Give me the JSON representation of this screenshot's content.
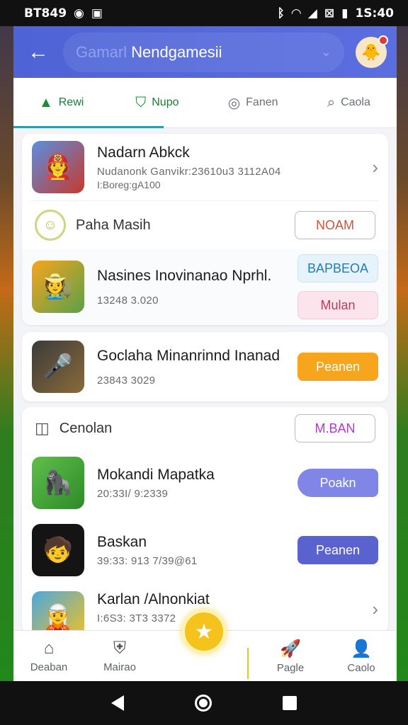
{
  "status_bar": {
    "left_text": "BT849",
    "time": "1S:40"
  },
  "header": {
    "search_placeholder": "Gamarl",
    "search_text": "Nendgamesii",
    "chevron": "⌄"
  },
  "tabs": [
    {
      "label": "Rewi",
      "icon": "warning-triangle-icon"
    },
    {
      "label": "Nupo",
      "icon": "badge-icon"
    },
    {
      "label": "Fanen",
      "icon": "chat-icon"
    },
    {
      "label": "Caola",
      "icon": "search-icon"
    }
  ],
  "card1": {
    "title": "Nadarn Abkck",
    "sub": "Nudanonk Ganvikr:23610u3 3112A04",
    "sub2": "I:Boreg:gA100"
  },
  "section_pala": {
    "label": "Paha Masih",
    "button": "NOAM"
  },
  "app_nasines": {
    "title": "Nasines Inovinanao Nprhl.",
    "sub": "13248 3.020",
    "button1": "BAPBEOA",
    "button2": "Mulan"
  },
  "app_goclaha": {
    "title": "Goclaha Minanrinnd Inanad",
    "sub": "23843 3029",
    "button": "Peanen"
  },
  "section_cenolan": {
    "label": "Cenolan",
    "button": "M.BAN"
  },
  "app_mokandi": {
    "title": "Mokandi Mapatka",
    "sub": "20:33I/ 9:2339",
    "button": "Poakn"
  },
  "app_baskan": {
    "title": "Baskan",
    "sub": "39:33: 913 7/39@61",
    "button": "Peanen"
  },
  "app_karlan": {
    "title": "Karlan /Alnonkiat",
    "sub": "I:6S3: 3T3 3372"
  },
  "bottom_nav": [
    {
      "label": "Deaban",
      "icon": "home-icon"
    },
    {
      "label": "Mairao",
      "icon": "shield-icon"
    },
    {
      "label": "Pagle",
      "icon": "rocket-icon"
    },
    {
      "label": "Caolo",
      "icon": "profile-icon"
    }
  ],
  "colors": {
    "appbar": "#4e63d6",
    "orange_button": "#f7a51c",
    "indigo_button": "#5a62cf",
    "lavender_button": "#7f86e6"
  }
}
